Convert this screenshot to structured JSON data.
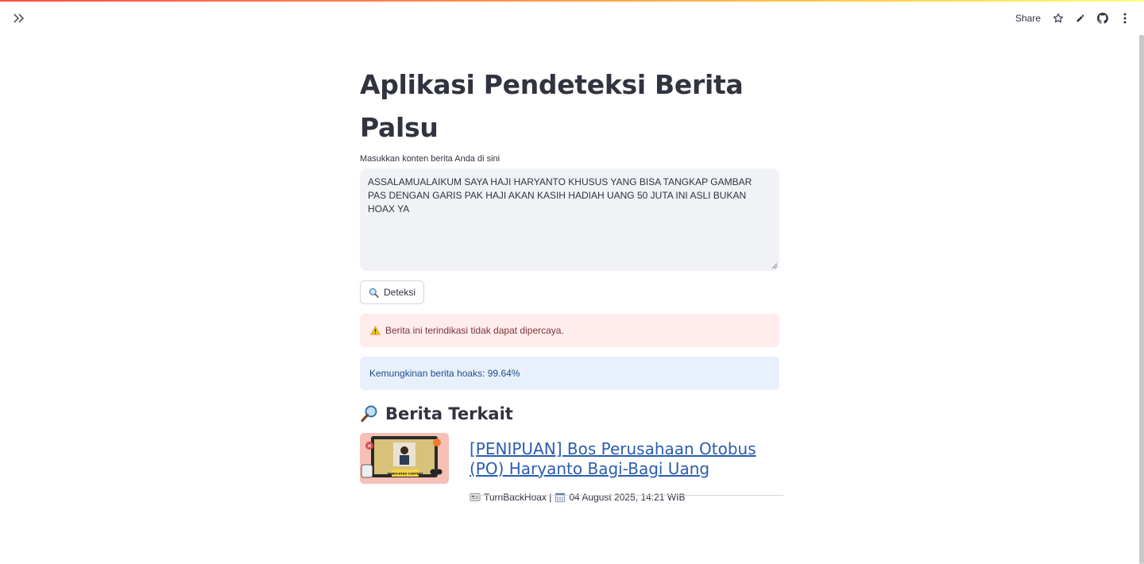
{
  "header": {
    "share_label": "Share",
    "icons": [
      "star-icon",
      "pencil-icon",
      "github-icon",
      "more-vert-icon"
    ]
  },
  "main": {
    "title": "Aplikasi Pendeteksi Berita Palsu",
    "input_label": "Masukkan konten berita Anda di sini",
    "input_value": "ASSALAMUALAIKUM SAYA HAJI HARYANTO KHUSUS YANG BISA TANGKAP GAMBAR PAS DENGAN GARIS PAK HAJI AKAN KASIH HADIAH UANG 50 JUTA INI ASLI BUKAN HOAX YA",
    "detect_button": "Deteksi",
    "warning_text": "Berita ini terindikasi tidak dapat dipercaya.",
    "info_text": "Kemungkinan berita hoaks: 99.64%"
  },
  "related": {
    "heading": "Berita Terkait",
    "items": [
      {
        "title": "[PENIPUAN] Bos Perusahaan Otobus (PO) Haryanto Bagi-Bagi Uang",
        "source": "TurnBackHoax |",
        "date": "04 August 2025, 14:21 WIB",
        "thumb_caption": "FABRICATED CONTENT"
      }
    ]
  },
  "colors": {
    "link": "#2a5db0",
    "warning_bg": "#ffecec",
    "info_bg": "#e8f0fb",
    "textarea_bg": "#f0f2f6"
  }
}
